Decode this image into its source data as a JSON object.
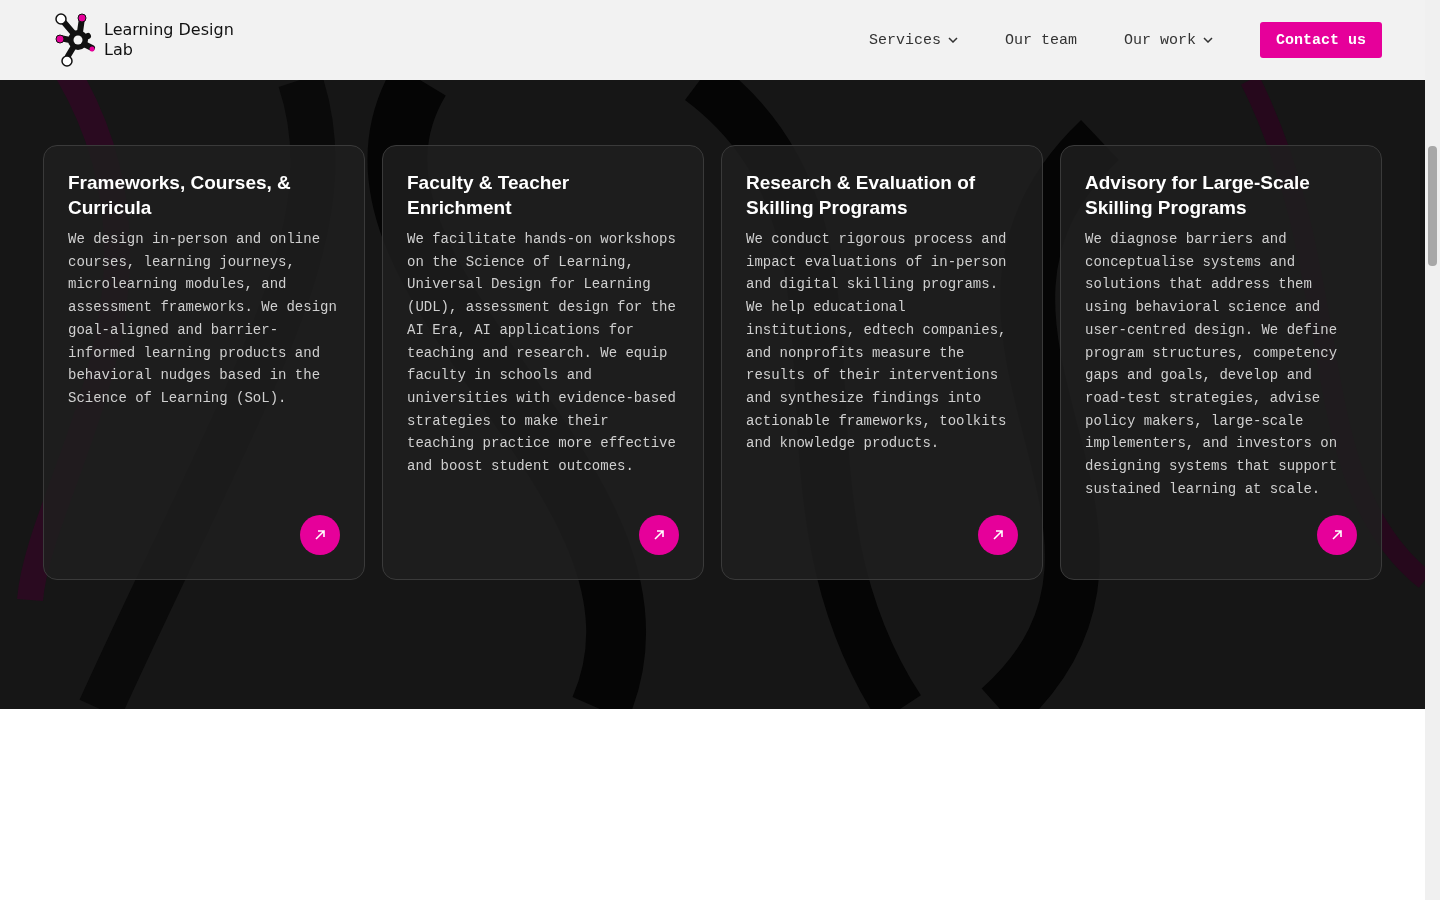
{
  "header": {
    "logo_text": "Learning Design Lab",
    "nav": [
      {
        "label": "Services",
        "has_menu": true
      },
      {
        "label": "Our team",
        "has_menu": false
      },
      {
        "label": "Our work",
        "has_menu": true
      }
    ],
    "contact_button": "Contact us"
  },
  "cards": [
    {
      "title": "Frameworks, Courses, & Curricula",
      "body": "We design in-person and online courses, learning journeys, microlearning modules, and assessment frameworks. We design goal-aligned and barrier-informed learning products and behavioral nudges based in the Science of Learning (SoL)."
    },
    {
      "title": "Faculty & Teacher Enrichment",
      "body": "We facilitate hands-on workshops on the Science of Learning, Universal Design for Learning (UDL), assessment design for the AI Era, AI applications for teaching and research. We equip faculty in schools and universities with evidence-based strategies to make their teaching practice more effective and boost student outcomes."
    },
    {
      "title": "Research & Evaluation of Skilling Programs",
      "body": "We conduct rigorous process and impact evaluations of in-person and digital skilling programs. We help educational institutions, edtech companies, and nonprofits measure the results of their interventions and synthesize findings into actionable frameworks, toolkits and knowledge products."
    },
    {
      "title": "Advisory for Large-Scale Skilling Programs",
      "body": "We diagnose barriers and conceptualise systems and solutions that address them using behavioral science and user-centred design. We define program structures, competency gaps and goals, develop and road-test strategies, advise policy makers, large-scale implementers, and investors on designing systems that support sustained learning at scale."
    }
  ]
}
